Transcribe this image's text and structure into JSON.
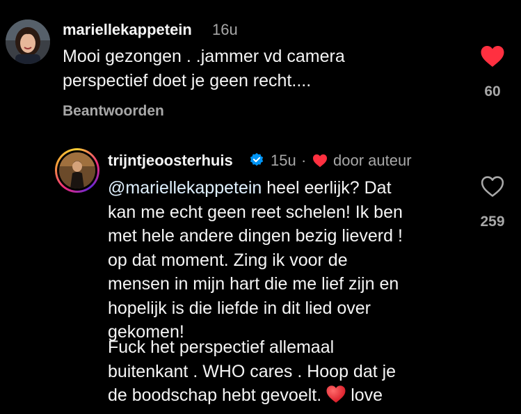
{
  "comment": {
    "username": "mariellekappetein",
    "time": "16u",
    "lines": [
      "Mooi gezongen . .jammer vd camera",
      "perspectief doet je geen recht...."
    ],
    "reply_label": "Beantwoorden",
    "like_count": "60",
    "liked": true
  },
  "reply": {
    "username": "trijntjeoosterhuis",
    "verified": true,
    "time": "15u",
    "separator": "·",
    "author_badge": "door auteur",
    "mention": "@mariellekappetein",
    "first_line_rest": " heel eerlijk? Dat",
    "lines": [
      "kan me echt geen reet schelen! Ik ben",
      "met hele andere dingen bezig lieverd !",
      "op dat moment. Zing ik voor de",
      "mensen in mijn hart die me lief zijn en",
      "hopelijk is die liefde in dit lied over",
      "gekomen!"
    ],
    "paragraph2": [
      "Fuck het perspectief allemaal",
      "buitenkant . WHO cares . Hoop dat je",
      "de boodschap hebt gevoelt."
    ],
    "trailing_word": "love",
    "like_count": "259",
    "liked": false
  },
  "colors": {
    "background": "#000000",
    "text": "#f5f5f5",
    "secondary": "#a8a8a8",
    "like_red": "#ff3040",
    "verified_blue": "#0095f6",
    "mention": "#e0f1ff"
  },
  "icons": {
    "liked": "heart-filled-icon",
    "unliked": "heart-outline-icon",
    "verified": "verified-badge-icon",
    "author": "heart-small-icon",
    "emoji": "red-heart-emoji-icon"
  }
}
